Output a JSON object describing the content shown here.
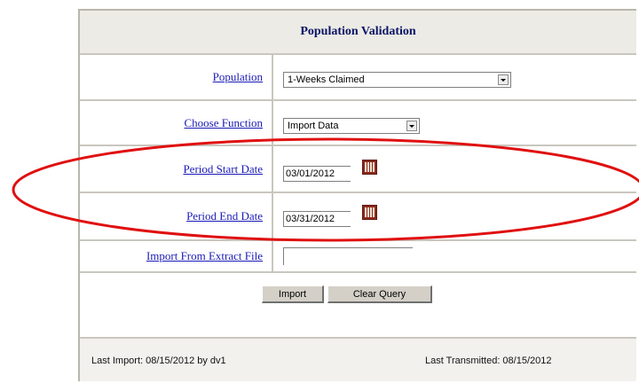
{
  "title": "Population Validation",
  "fields": {
    "population": {
      "label": "Population",
      "value": "1-Weeks Claimed"
    },
    "function": {
      "label": "Choose Function",
      "value": "Import Data"
    },
    "start_date": {
      "label": "Period Start Date",
      "value": "03/01/2012"
    },
    "end_date": {
      "label": "Period End Date",
      "value": "03/31/2012"
    },
    "import_file": {
      "label": "Import From Extract File",
      "value": ""
    }
  },
  "buttons": {
    "import": "Import",
    "clear_query": "Clear Query"
  },
  "footer": {
    "last_import": "Last Import: 08/15/2012 by dv1",
    "last_transmitted": "Last Transmitted: 08/15/2012"
  },
  "annotation": {
    "color": "#e01010",
    "shape": "ellipse"
  }
}
